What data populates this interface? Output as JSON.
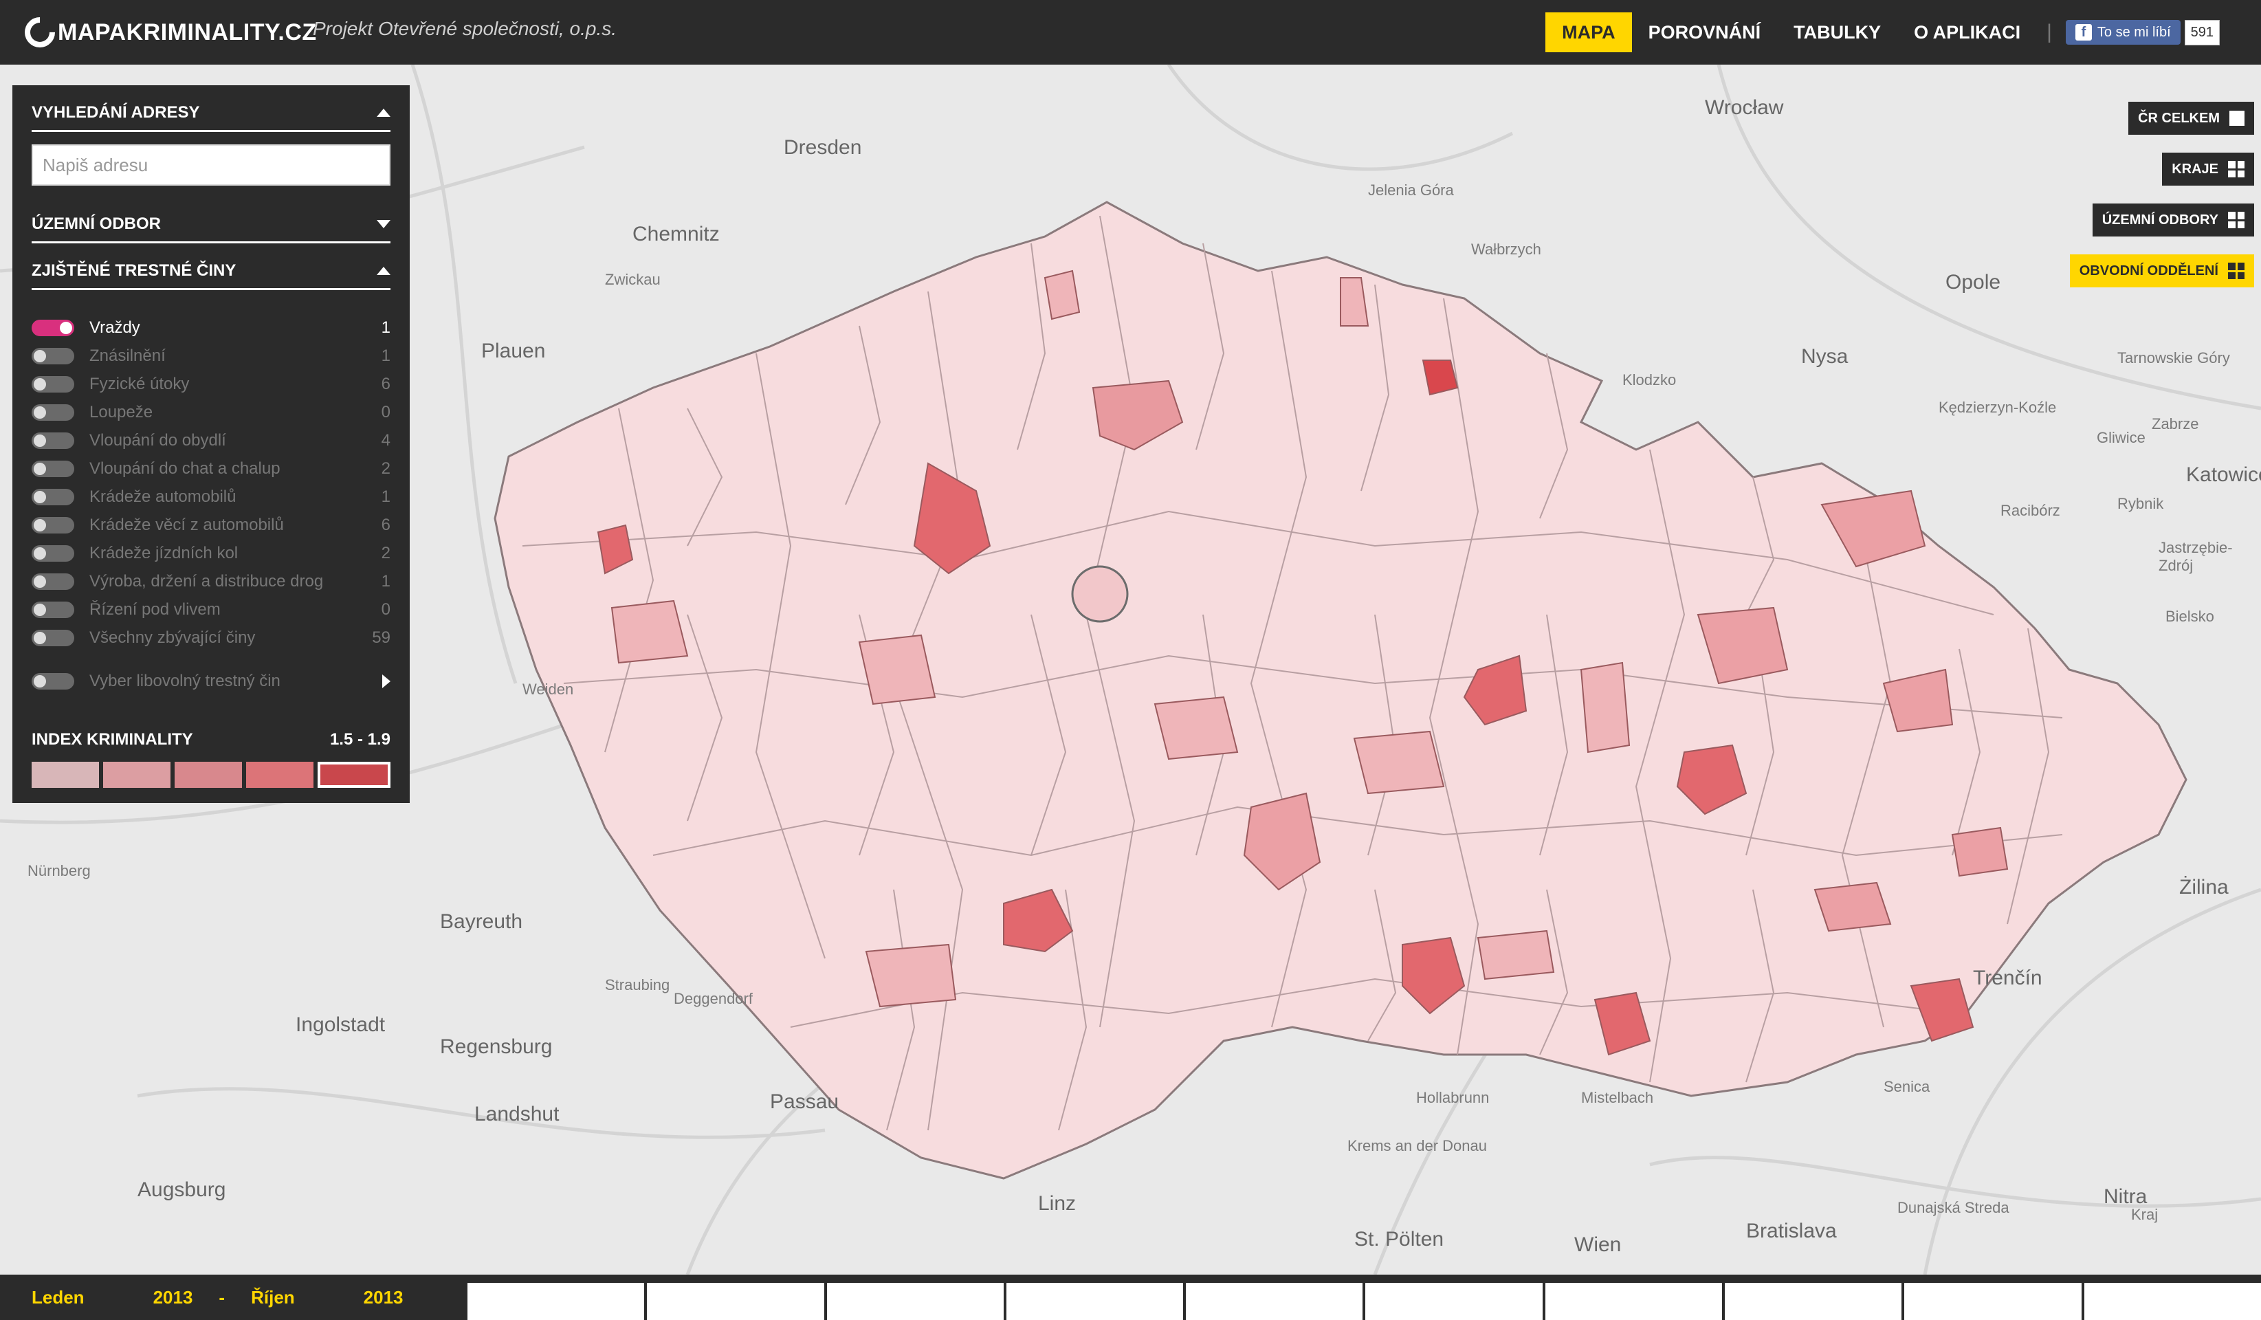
{
  "header": {
    "logo_text": "MAPAKRIMINALITY.CZ",
    "tagline": "Projekt Otevřené společnosti, o.p.s.",
    "nav": [
      "MAPA",
      "POROVNÁNÍ",
      "TABULKY",
      "O APLIKACI"
    ],
    "active_nav": "MAPA",
    "separator": "|",
    "fb_like_label": "To se mi líbí",
    "fb_like_count": "591"
  },
  "map_layers": {
    "items": [
      "ČR CELKEM",
      "KRAJE",
      "ÚZEMNÍ ODBORY",
      "OBVODNÍ ODDĚLENÍ"
    ],
    "active": "OBVODNÍ ODDĚLENÍ"
  },
  "panel": {
    "address_section": "VYHLEDÁNÍ ADRESY",
    "address_placeholder": "Napiš adresu",
    "territory_section": "ÚZEMNÍ ODBOR",
    "crimes_section": "ZJIŠTĚNÉ TRESTNÉ ČINY",
    "crimes": [
      {
        "label": "Vraždy",
        "count": "1",
        "on": true
      },
      {
        "label": "Znásilnění",
        "count": "1",
        "on": false
      },
      {
        "label": "Fyzické útoky",
        "count": "6",
        "on": false
      },
      {
        "label": "Loupeže",
        "count": "0",
        "on": false
      },
      {
        "label": "Vloupání do obydlí",
        "count": "4",
        "on": false
      },
      {
        "label": "Vloupání do chat a chalup",
        "count": "2",
        "on": false
      },
      {
        "label": "Krádeže automobilů",
        "count": "1",
        "on": false
      },
      {
        "label": "Krádeže věcí z automobilů",
        "count": "6",
        "on": false
      },
      {
        "label": "Krádeže jízdních kol",
        "count": "2",
        "on": false
      },
      {
        "label": "Výroba, držení a distribuce drog",
        "count": "1",
        "on": false
      },
      {
        "label": "Řízení pod vlivem",
        "count": "0",
        "on": false
      },
      {
        "label": "Všechny zbývající činy",
        "count": "59",
        "on": false
      }
    ],
    "custom_crime": "Vyber libovolný trestný čin",
    "index_title": "INDEX KRIMINALITY",
    "index_range": "1.5 - 1.9",
    "legend_colors": [
      "#d8b6b8",
      "#dc9ea2",
      "#d8888d",
      "#dc7478",
      "#c9474c"
    ],
    "legend_selected": 4
  },
  "daterange": {
    "from_month": "Leden",
    "from_year": "2013",
    "dash": "-",
    "to_month": "Říjen",
    "to_year": "2013"
  },
  "places": [
    "Dresden",
    "Chemnitz",
    "Wrocław",
    "Zwickau",
    "Plauen",
    "Jelenia Góra",
    "Wałbrzych",
    "Opole",
    "Nysa",
    "Klodzko",
    "Kraj",
    "Bayreuth",
    "Regensburg",
    "Ingolstadt",
    "Landshut",
    "Passau",
    "Linz",
    "St. Pölten",
    "Wien",
    "Bratislava",
    "Trenčín",
    "Żilina",
    "Katowice",
    "Rybnik",
    "Gliwice",
    "Nürnberg",
    "Augsburg",
    "Deggendorf",
    "Straubing",
    "Weiden",
    "Krems an der Donau",
    "Mistelbach",
    "Hollabrunn",
    "Tarnowskie Góry",
    "Racibórz",
    "Jastrzębie-Zdrój",
    "Bielsko",
    "Zabrze",
    "Kędzierzyn-Koźle",
    "Nitra",
    "Senica",
    "Dunajská Streda"
  ]
}
